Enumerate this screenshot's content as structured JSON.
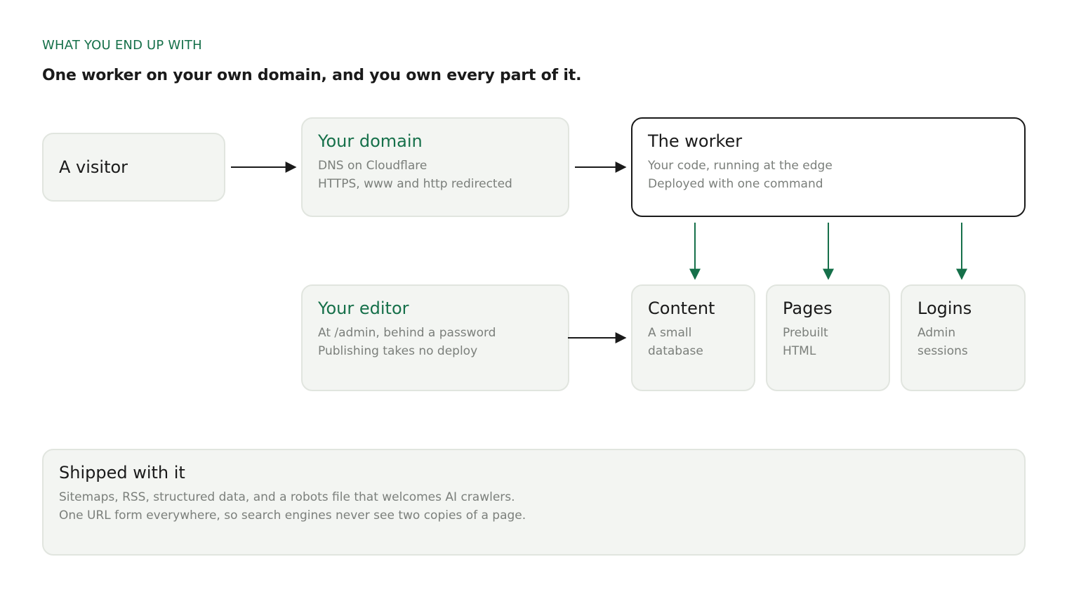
{
  "header": {
    "eyebrow": "WHAT YOU END UP WITH",
    "headline": "One worker on your own domain, and you own every part of it."
  },
  "nodes": {
    "visitor": {
      "title": "A visitor"
    },
    "domain": {
      "title": "Your domain",
      "lines": [
        "DNS on Cloudflare",
        "HTTPS, www and http redirected"
      ]
    },
    "worker": {
      "title": "The worker",
      "lines": [
        "Your code, running at the edge",
        "Deployed with one command"
      ]
    },
    "editor": {
      "title": "Your editor",
      "lines": [
        "At /admin, behind a password",
        "Publishing takes no deploy"
      ]
    },
    "content": {
      "title": "Content",
      "lines": [
        "A small",
        "database"
      ]
    },
    "pages": {
      "title": "Pages",
      "lines": [
        "Prebuilt",
        "HTML"
      ]
    },
    "logins": {
      "title": "Logins",
      "lines": [
        "Admin",
        "sessions"
      ]
    }
  },
  "footer": {
    "title": "Shipped with it",
    "lines": [
      "Sitemaps, RSS, structured data, and a robots file that welcomes AI crawlers.",
      "One URL form everywhere, so search engines never see two copies of a page."
    ]
  },
  "colors": {
    "accent": "#16704a",
    "dark": "#1a1a1a",
    "muted": "#7b7f7b",
    "box_bg": "#f3f5f2"
  }
}
